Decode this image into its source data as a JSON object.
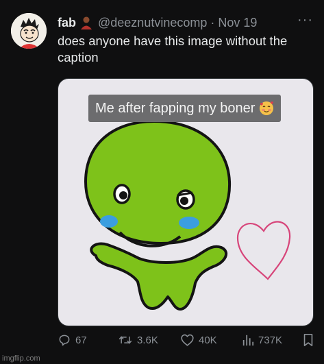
{
  "tweet": {
    "author": {
      "display_name": "fab",
      "handle": "@deeznutvinecomp",
      "separator": "·",
      "date": "Nov 19",
      "avatar_icon": "cartoon-boy-avatar",
      "badge_icon": "person-emoji-icon"
    },
    "more_label": "···",
    "text": "does anyone have this image without the caption",
    "media": {
      "caption": "Me after fapping my boner",
      "caption_emoji": "smiling-face-with-hearts-emoji",
      "colors": {
        "background": "#e9e7ec",
        "creature": "#7ec21a",
        "outline": "#141414",
        "cheeks": "#3b9ee0",
        "heart": "#d7457a"
      }
    },
    "actions": {
      "replies": "67",
      "reposts": "3.6K",
      "likes": "40K",
      "views": "737K"
    }
  },
  "watermark": "imgflip.com"
}
